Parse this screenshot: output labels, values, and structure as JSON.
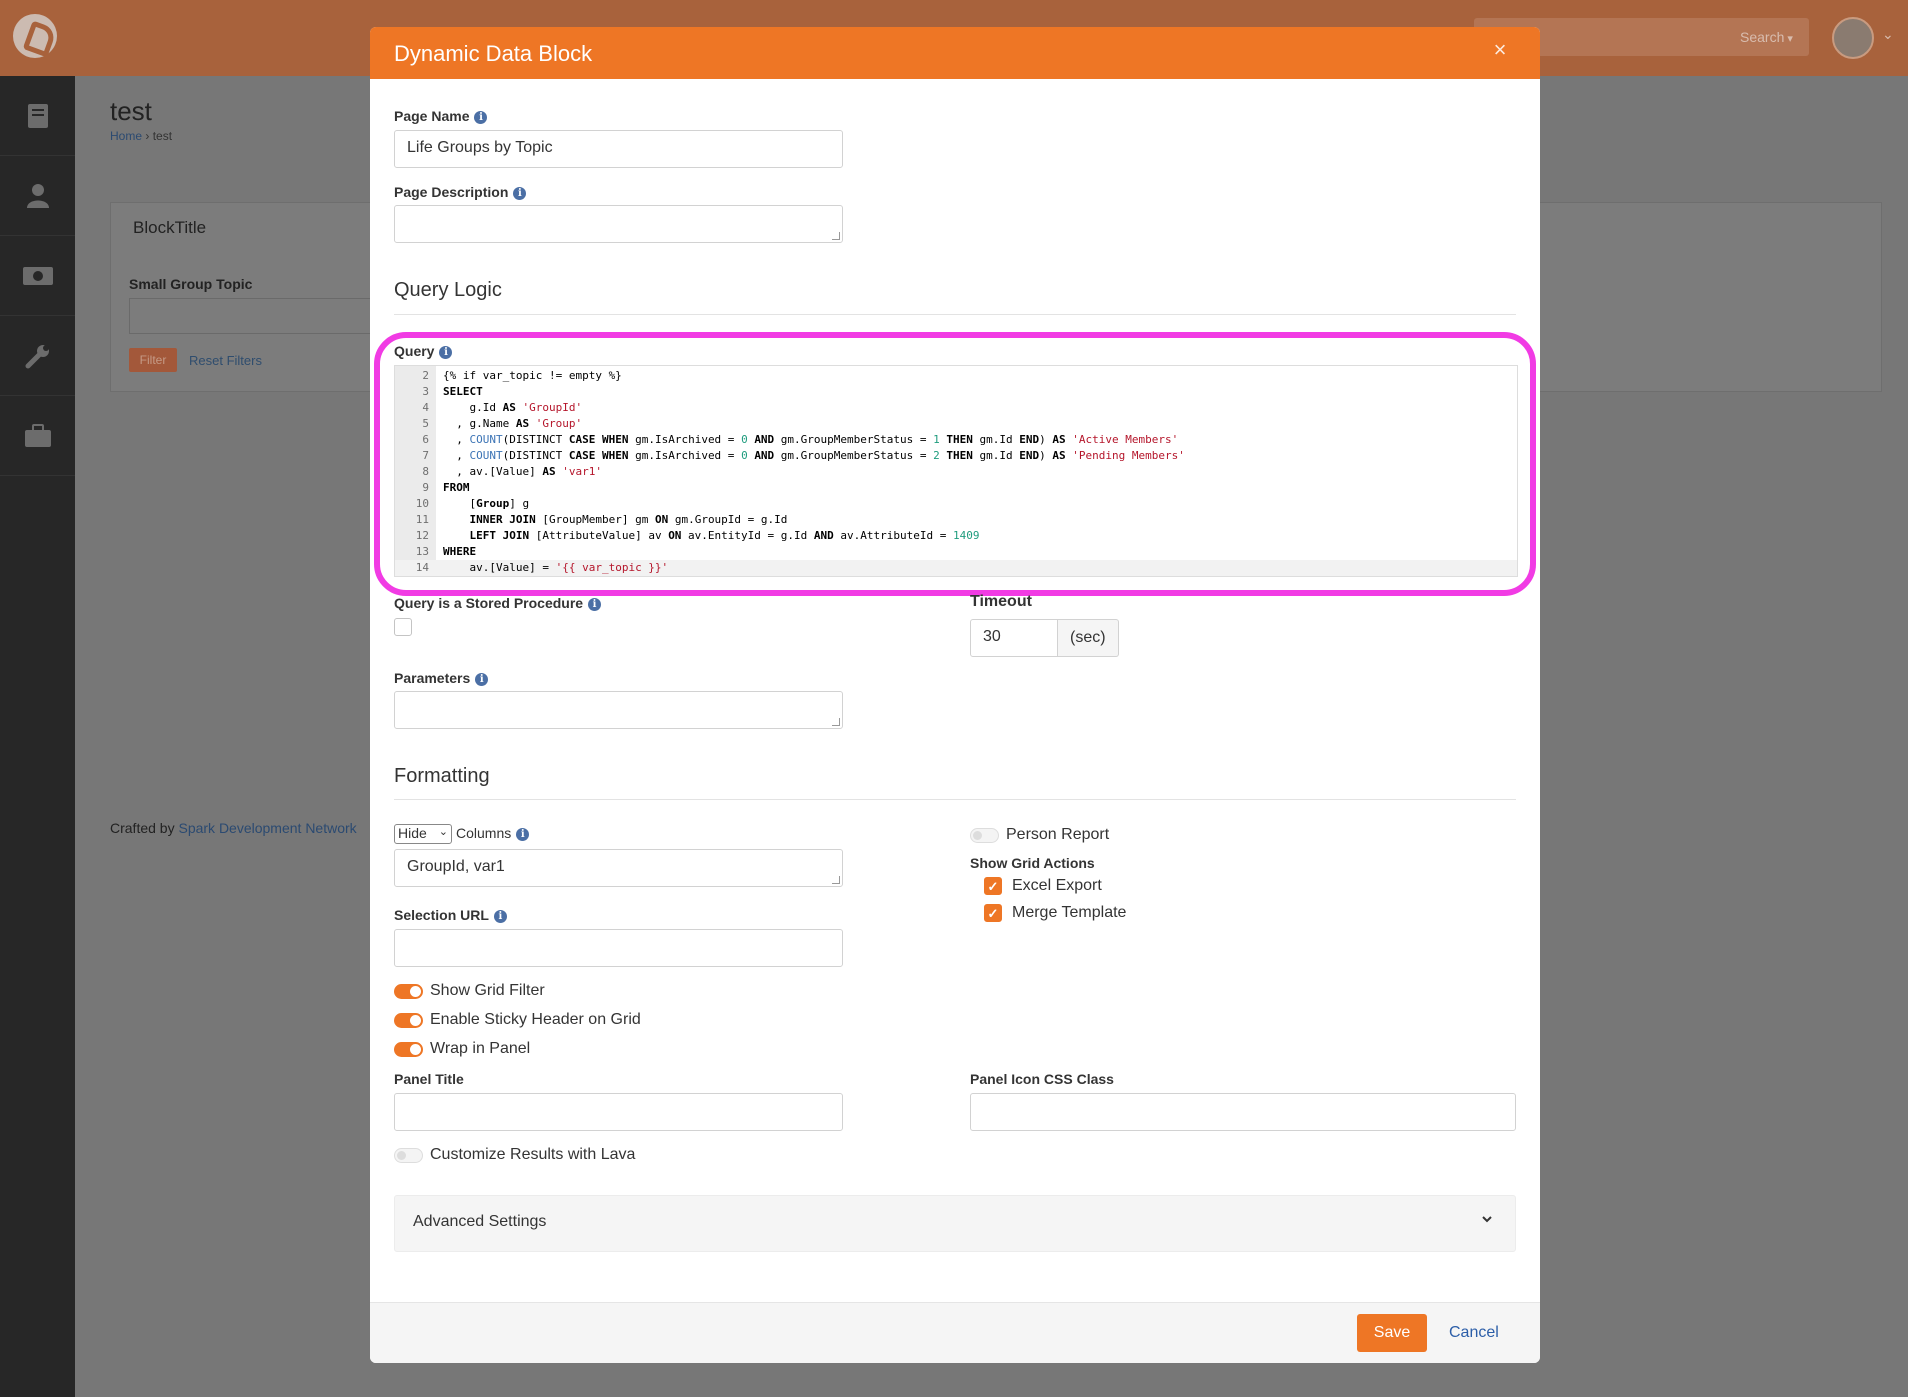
{
  "background": {
    "page_title": "test",
    "breadcrumb": {
      "home": "Home",
      "sep": "›",
      "current": "test"
    },
    "panel_title": "BlockTitle",
    "filter_label": "Small Group Topic",
    "filter_button": "Filter",
    "reset_filters": "Reset Filters",
    "crafted_by_prefix": "Crafted by ",
    "crafted_by_link": "Spark Development Network",
    "search_label": "Search"
  },
  "modal": {
    "title": "Dynamic Data Block",
    "page_name": {
      "label": "Page Name",
      "value": "Life Groups by Topic"
    },
    "page_description": {
      "label": "Page Description",
      "value": ""
    },
    "query_logic_title": "Query Logic",
    "query": {
      "label": "Query",
      "lines": [
        {
          "n": "2",
          "html": "{% if var_topic != empty %}"
        },
        {
          "n": "3",
          "html": "<span class='kw'>SELECT</span>"
        },
        {
          "n": "4",
          "html": "    g.Id <span class='kw'>AS</span> <span class='str'>'GroupId'</span>"
        },
        {
          "n": "5",
          "html": "  , g.Name <span class='kw'>AS</span> <span class='str'>'Group'</span>"
        },
        {
          "n": "6",
          "html": "  , <span class='fn'>COUNT</span>(DISTINCT <span class='kw'>CASE WHEN</span> gm.IsArchived = <span class='num'>0</span> <span class='kw'>AND</span> gm.GroupMemberStatus = <span class='num'>1</span> <span class='kw'>THEN</span> gm.Id <span class='kw'>END</span>) <span class='kw'>AS</span> <span class='str'>'Active Members'</span>"
        },
        {
          "n": "7",
          "html": "  , <span class='fn'>COUNT</span>(DISTINCT <span class='kw'>CASE WHEN</span> gm.IsArchived = <span class='num'>0</span> <span class='kw'>AND</span> gm.GroupMemberStatus = <span class='num'>2</span> <span class='kw'>THEN</span> gm.Id <span class='kw'>END</span>) <span class='kw'>AS</span> <span class='str'>'Pending Members'</span>"
        },
        {
          "n": "8",
          "html": "  , av.[Value] <span class='kw'>AS</span> <span class='str'>'var1'</span>"
        },
        {
          "n": "9",
          "html": "<span class='kw'>FROM</span>"
        },
        {
          "n": "10",
          "html": "    [<span class='kw'>Group</span>] g"
        },
        {
          "n": "11",
          "html": "    <span class='kw'>INNER JOIN</span> [GroupMember] gm <span class='kw'>ON</span> gm.GroupId = g.Id"
        },
        {
          "n": "12",
          "html": "    <span class='kw'>LEFT JOIN</span> [AttributeValue] av <span class='kw'>ON</span> av.EntityId = g.Id <span class='kw'>AND</span> av.AttributeId = <span class='num'>1409</span>"
        },
        {
          "n": "13",
          "html": "<span class='kw'>WHERE</span>"
        },
        {
          "n": "14",
          "html": "    av.[Value] = <span class='str'>'{{ var_topic }}'</span>"
        }
      ]
    },
    "stored_procedure": {
      "label": "Query is a Stored Procedure",
      "checked": false
    },
    "timeout": {
      "label": "Timeout",
      "value": "30",
      "unit": "(sec)"
    },
    "parameters": {
      "label": "Parameters",
      "value": ""
    },
    "formatting_title": "Formatting",
    "columns": {
      "mode": "Hide",
      "label": "Columns",
      "value": "GroupId, var1"
    },
    "person_report": {
      "label": "Person Report",
      "on": false
    },
    "grid_actions": {
      "label": "Show Grid Actions",
      "excel_export": "Excel Export",
      "merge_template": "Merge Template"
    },
    "selection_url": {
      "label": "Selection URL",
      "value": ""
    },
    "show_grid_filter": {
      "label": "Show Grid Filter",
      "on": true
    },
    "sticky_header": {
      "label": "Enable Sticky Header on Grid",
      "on": true
    },
    "wrap_in_panel": {
      "label": "Wrap in Panel",
      "on": true
    },
    "panel_title": {
      "label": "Panel Title",
      "value": ""
    },
    "panel_icon": {
      "label": "Panel Icon CSS Class",
      "value": ""
    },
    "customize_lava": {
      "label": "Customize Results with Lava",
      "on": false
    },
    "advanced_settings": "Advanced Settings",
    "save": "Save",
    "cancel": "Cancel"
  },
  "colors": {
    "accent": "#ee7625",
    "highlight": "#f13be4",
    "link": "#2c5ea8"
  }
}
